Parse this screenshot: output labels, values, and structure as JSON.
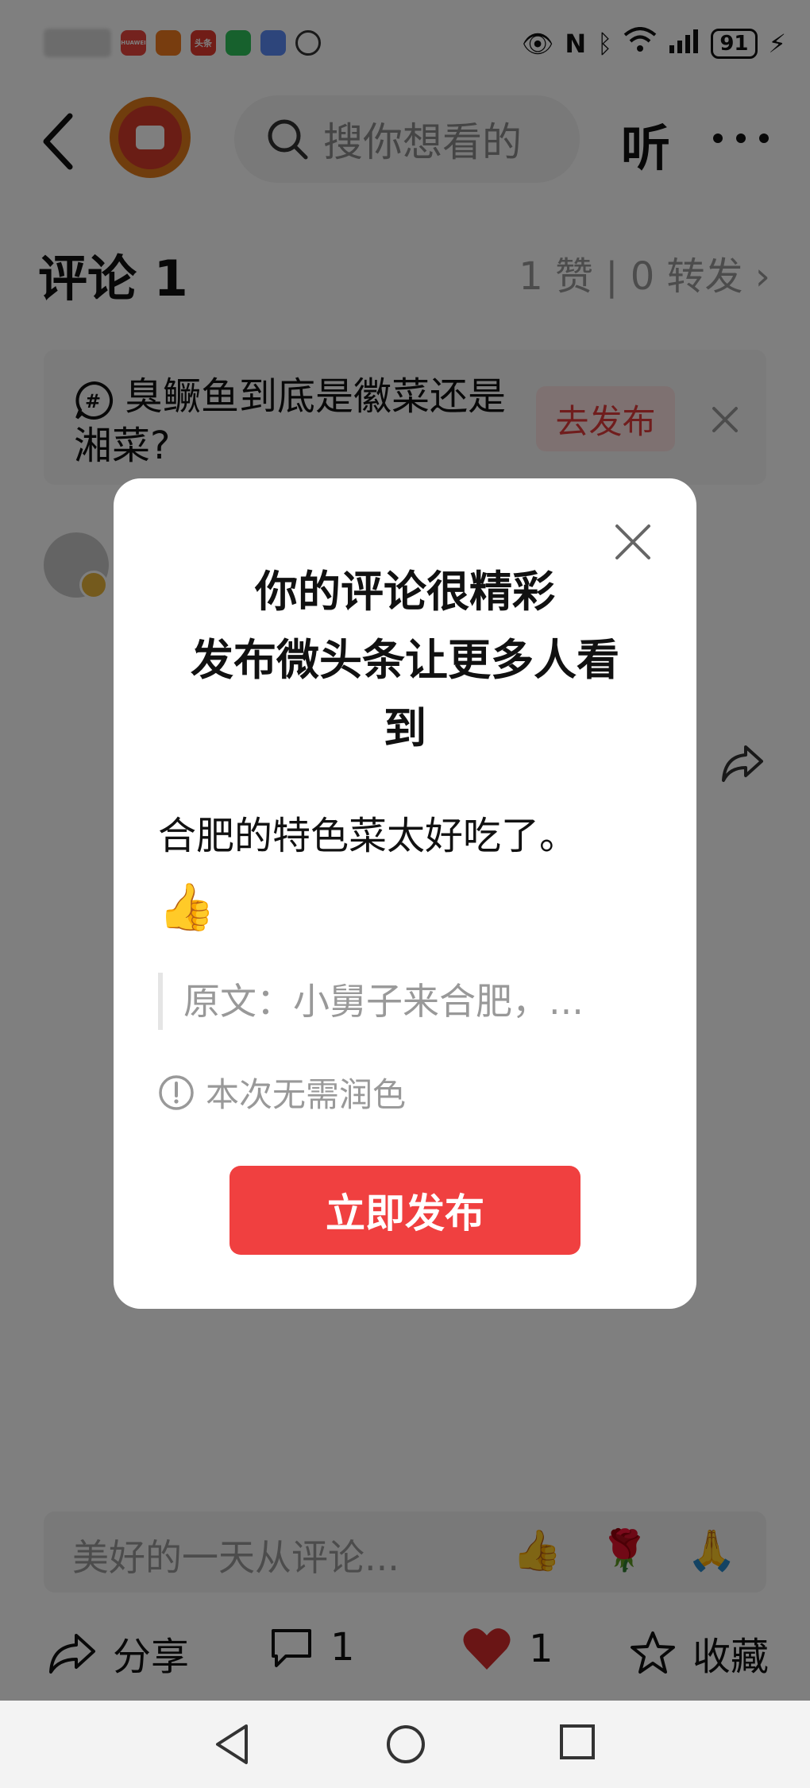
{
  "status_bar": {
    "battery": "91",
    "apps": [
      {
        "label": "HUAWEI",
        "color": "#e8453c"
      },
      {
        "label": "",
        "color": "#f07b1e"
      },
      {
        "label": "头条",
        "color": "#e33a2f"
      },
      {
        "label": "",
        "color": "#2fc25b"
      },
      {
        "label": "",
        "color": "#5b8af7"
      },
      {
        "label": "",
        "color": "#333333"
      }
    ]
  },
  "header": {
    "search_placeholder": "搜你想看的",
    "listen_label": "听"
  },
  "comments": {
    "title": "评论 1",
    "stats": "1 赞 | 0 转发"
  },
  "topic_card": {
    "text": "臭鳜鱼到底是徽菜还是湘菜?",
    "button": "去发布"
  },
  "bottom_input": {
    "placeholder": "美好的一天从评论...",
    "emojis": [
      "👍",
      "🌹",
      "🙏"
    ]
  },
  "bottom_bar": {
    "share": "分享",
    "comment_count": "1",
    "like_count": "1",
    "favorite": "收藏"
  },
  "modal": {
    "title_line1": "你的评论很精彩",
    "title_line2": "发布微头条让更多人看",
    "title_line3": "到",
    "comment": "合肥的特色菜太好吃了。",
    "emoji": "👍",
    "quote": "原文：小舅子来合肥，...",
    "hint": "本次无需润色",
    "publish_button": "立即发布"
  },
  "colors": {
    "accent": "#f04040",
    "topic_button_bg": "#fde3e3",
    "like_heart": "#d42a2a"
  }
}
